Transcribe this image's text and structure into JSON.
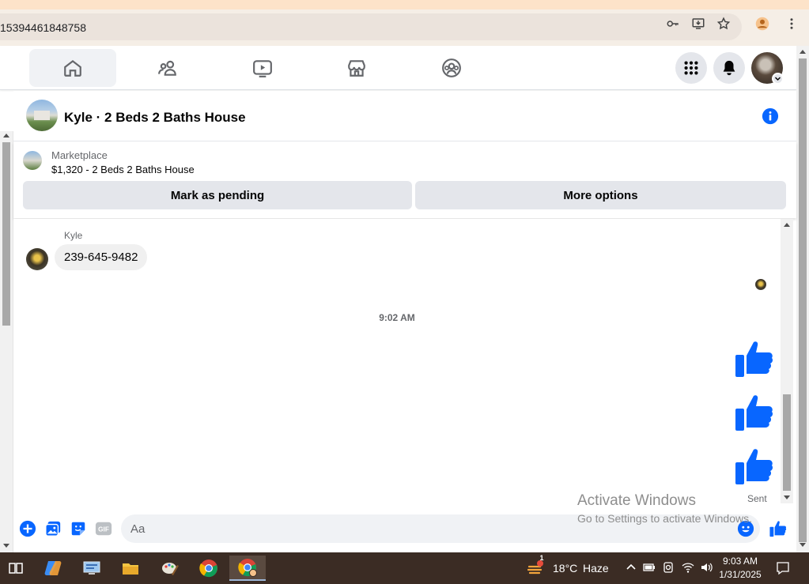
{
  "browser": {
    "url": "15394461848758"
  },
  "chat": {
    "title": "Kyle · 2 Beds 2 Baths House"
  },
  "marketplace": {
    "label": "Marketplace",
    "listing": "$1,320 - 2 Beds 2 Baths House",
    "mark_pending_label": "Mark as pending",
    "more_options_label": "More options"
  },
  "messages": {
    "sender_name": "Kyle",
    "incoming_text": "239-645-9482",
    "timestamp": "9:02 AM",
    "status": "Sent"
  },
  "composer": {
    "placeholder": "Aa",
    "gif_label": "GIF"
  },
  "watermark": {
    "title": "Activate Windows",
    "subtitle": "Go to Settings to activate Windows."
  },
  "taskbar": {
    "weather_temp": "18°C",
    "weather_desc": "Haze",
    "weather_badge": "1",
    "time": "9:03 AM",
    "date": "1/31/2025"
  },
  "colors": {
    "accent": "#0866ff",
    "like_blue": "#0866ff"
  }
}
